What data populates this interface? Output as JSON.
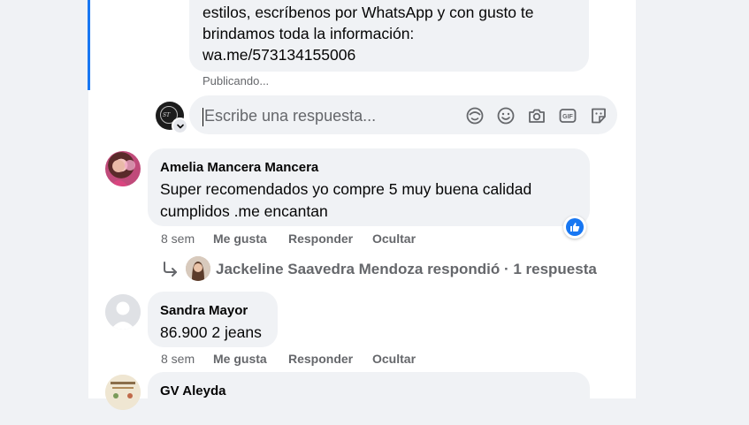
{
  "post": {
    "lines": [
      "estilos, escríbenos por WhatsApp y con gusto te",
      "brindamos toda la información:",
      "wa.me/573134155006"
    ],
    "status": "Publicando..."
  },
  "composer": {
    "placeholder": "Escribe una respuesta...",
    "icons": [
      "avatar-sticker-icon",
      "emoji-icon",
      "camera-icon",
      "gif-icon",
      "sticker-icon"
    ]
  },
  "comments": [
    {
      "author": "Amelia Mancera Mancera",
      "lines": [
        "Super recomendados yo compre 5 muy buena calidad",
        "cumplidos .me encantan"
      ],
      "time": "8 sem",
      "like": "Me gusta",
      "reply": "Responder",
      "hide": "Ocultar",
      "reaction": "like",
      "replies": {
        "text": "Jackeline Saavedra Mendoza respondió · 1 respuesta"
      }
    },
    {
      "author": "Sandra Mayor",
      "lines": [
        "86.900 2 jeans"
      ],
      "time": "8 sem",
      "like": "Me gusta",
      "reply": "Responder",
      "hide": "Ocultar"
    },
    {
      "author": "GV Aleyda",
      "lines": []
    }
  ],
  "colors": {
    "accent": "#1877f2",
    "bubble": "#f0f2f5",
    "secondary_text": "#65676b"
  }
}
